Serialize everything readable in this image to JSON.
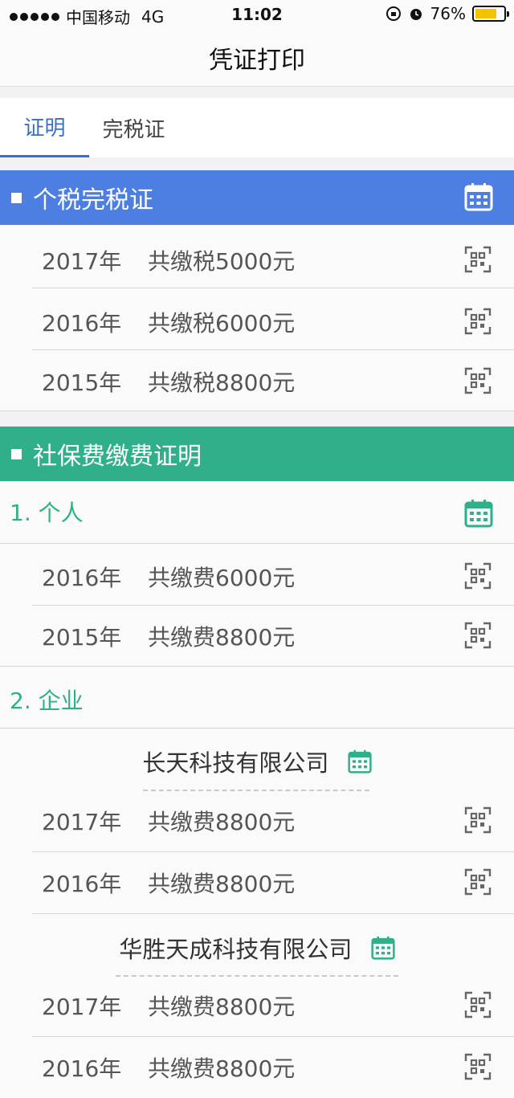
{
  "status_bar": {
    "carrier": "中国移动",
    "network": "4G",
    "time": "11:02",
    "battery_percent": "76%",
    "battery_level": 0.76
  },
  "nav": {
    "title": "凭证打印"
  },
  "tabs": [
    {
      "label": "证明",
      "active": true
    },
    {
      "label": "完税证",
      "active": false
    }
  ],
  "tax_section": {
    "title": "个税完税证",
    "color": "#4d7ee2",
    "rows": [
      {
        "year": "2017年",
        "amount": "共缴税5000元"
      },
      {
        "year": "2016年",
        "amount": "共缴税6000元"
      },
      {
        "year": "2015年",
        "amount": "共缴税8800元"
      }
    ]
  },
  "social_section": {
    "title": "社保费缴费证明",
    "color": "#2fb08a",
    "personal": {
      "label": "1. 个人",
      "rows": [
        {
          "year": "2016年",
          "amount": "共缴费6000元"
        },
        {
          "year": "2015年",
          "amount": "共缴费8800元"
        }
      ]
    },
    "enterprise": {
      "label": "2. 企业",
      "companies": [
        {
          "name": "长天科技有限公司",
          "rows": [
            {
              "year": "2017年",
              "amount": "共缴费8800元"
            },
            {
              "year": "2016年",
              "amount": "共缴费8800元"
            }
          ]
        },
        {
          "name": "华胜天成科技有限公司",
          "rows": [
            {
              "year": "2017年",
              "amount": "共缴费8800元"
            },
            {
              "year": "2016年",
              "amount": "共缴费8800元"
            }
          ]
        }
      ]
    }
  }
}
